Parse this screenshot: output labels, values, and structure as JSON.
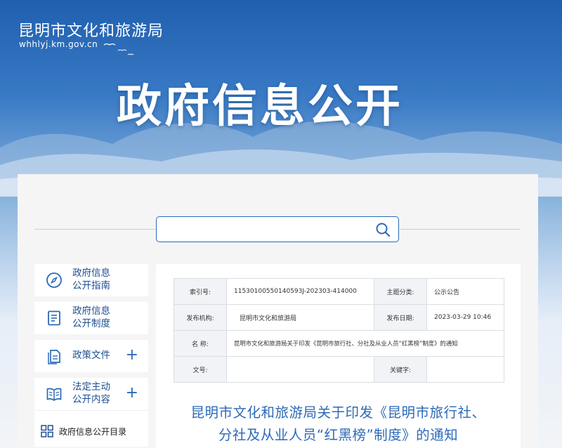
{
  "site": {
    "name": "昆明市文化和旅游局",
    "url": "whhlyj.km.gov.cn",
    "hero_title": "政府信息公开"
  },
  "search": {
    "placeholder": "",
    "value": "",
    "icon": "search-icon"
  },
  "sidebar": {
    "items": [
      {
        "label": "政府信息公开指南",
        "line1": "政府信息",
        "line2": "公开指南",
        "icon": "compass-icon",
        "expandable": false
      },
      {
        "label": "政府信息公开制度",
        "line1": "政府信息",
        "line2": "公开制度",
        "icon": "document-icon",
        "expandable": false
      },
      {
        "label": "政策文件",
        "line1": "政策文件",
        "line2": "",
        "icon": "files-icon",
        "expandable": true,
        "plus": "+"
      },
      {
        "label": "法定主动公开内容",
        "line1": "法定主动",
        "line2": "公开内容",
        "icon": "book-icon",
        "expandable": true,
        "plus": "+"
      }
    ],
    "sub": {
      "label": "政府信息公开目录",
      "icon": "grid-icon"
    }
  },
  "meta": {
    "index_label": "索引号:",
    "index_value": "11530100550140593J-202303-414000",
    "category_label": "主题分类:",
    "category_value": "公示公告",
    "publisher_label": "发布机构:",
    "publisher_value": "昆明市文化和旅游局",
    "date_label": "发布日期:",
    "date_value": "2023-03-29 10:46",
    "name_label": "名  称:",
    "name_value": "昆明市文化和旅游局关于印发《昆明市旅行社、分社及从业人员“红黑榜”制度》的通知",
    "docno_label": "文号:",
    "docno_value": "",
    "keywords_label": "关键字:",
    "keywords_value": ""
  },
  "notice": {
    "title_line1": "昆明市文化和旅游局关于印发《昆明市旅行社、",
    "title_line2": "分社及从业人员“红黑榜”制度》的通知"
  },
  "colors": {
    "brand_blue": "#2c69b7",
    "link_blue": "#1f4f93"
  }
}
